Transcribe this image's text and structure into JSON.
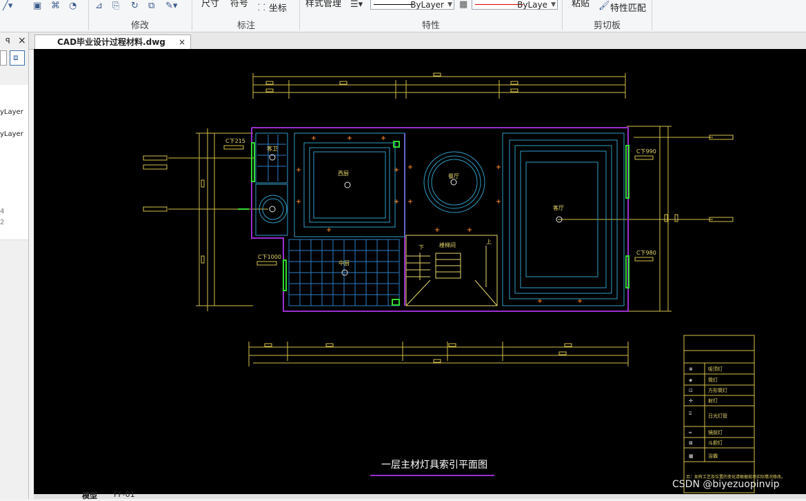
{
  "ribbon": {
    "groups": [
      "修改",
      "标注",
      "特性",
      "剪切板"
    ],
    "tools_partial": [
      "尺寸",
      "符号",
      "坐标",
      "样式管理",
      "粘贴",
      "特性匹配"
    ],
    "bylayer_1": "ByLayer",
    "bylayer_2": "ByLaye"
  },
  "left_panel": {
    "pin": "ꟼ",
    "close": "×",
    "rows": [
      "yLayer",
      "yLayer"
    ],
    "small_marks": [
      "4",
      "2"
    ]
  },
  "document": {
    "tab_title": "CAD毕业设计过程材料.dwg",
    "tab_close": "×"
  },
  "drawing": {
    "title": "一层主材灯具索引平面图",
    "rooms": [
      "客卫",
      "西厨",
      "餐厅",
      "客厅",
      "中厨",
      "楼梯间"
    ],
    "stair_labels": [
      "下",
      "上"
    ],
    "callouts": [
      "C下215",
      "C下990",
      "C下1000",
      "C下980"
    ],
    "legend": {
      "items": [
        "吸顶灯",
        "筒灯",
        "方形筒灯",
        "射灯",
        "日光灯管",
        "镜前灯",
        "斗胆灯",
        "浴霸"
      ],
      "note": "另：如有工艺及位置的变化请根据现场实际情况修改。"
    }
  },
  "bottom_tabs": [
    "模型",
    "FF-01"
  ],
  "watermark": "CSDN @biyezuopinvip",
  "colors": {
    "canvas": "#000000",
    "dim": "#d6c24a",
    "wall": "#9a2fcf",
    "detail": "#2f9fc7",
    "label": "#e8d86a",
    "green": "#33dd33",
    "lamp": "#ff8a2a"
  }
}
